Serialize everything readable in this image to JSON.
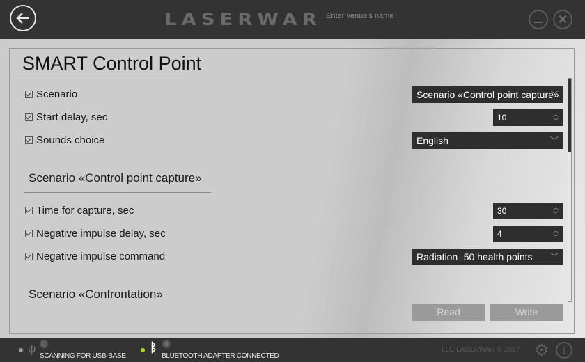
{
  "header": {
    "logo": "LASERWAR",
    "venue_placeholder": "Enter venue's name",
    "icons": {
      "back": "arrow-left-icon",
      "minimize": "minimize-icon",
      "close": "close-icon"
    }
  },
  "panel": {
    "title": "SMART Control Point",
    "general": [
      {
        "label": "Scenario",
        "checked": true,
        "control": "select",
        "value": "Scenario «Control point capture»"
      },
      {
        "label": "Start delay, sec",
        "checked": true,
        "control": "spinner",
        "value": "10"
      },
      {
        "label": "Sounds choice",
        "checked": true,
        "control": "select",
        "value": "English"
      }
    ],
    "section1": {
      "title": "Scenario «Control point capture»",
      "rows": [
        {
          "label": "Time for capture, sec",
          "checked": true,
          "control": "spinner",
          "value": "30"
        },
        {
          "label": "Negative impulse delay, sec",
          "checked": true,
          "control": "spinner",
          "value": "4"
        },
        {
          "label": "Negative impulse command",
          "checked": true,
          "control": "select",
          "value": "Radiation -50 health points"
        }
      ]
    },
    "section2": {
      "title": "Scenario «Confrontation»"
    },
    "buttons": {
      "read": "Read",
      "write": "Write"
    }
  },
  "status": {
    "usb": {
      "text": "SCANNING FOR USB-BASE",
      "count": "0",
      "dot_color": "#9a9a9a",
      "icon": "usb-icon"
    },
    "bluetooth": {
      "text": "BLUETOOTH ADAPTER CONNECTED",
      "count": "0",
      "dot_color": "#aadd22",
      "icon": "bluetooth-icon"
    },
    "copyright": "LLC LASERWAR © 2017",
    "icons": {
      "settings": "gear-icon",
      "info": "info-icon"
    }
  }
}
